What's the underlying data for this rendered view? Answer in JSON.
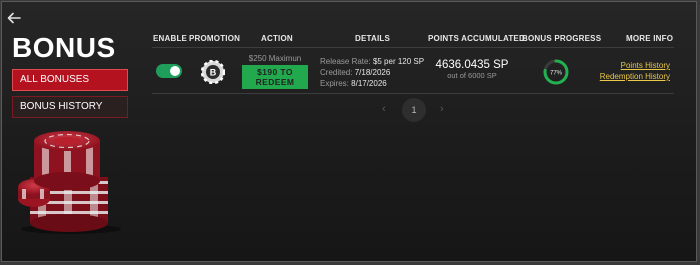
{
  "page": {
    "title": "BONUS"
  },
  "sidebar": {
    "items": [
      {
        "label": "ALL BONUSES",
        "active": true
      },
      {
        "label": "BONUS HISTORY",
        "active": false
      }
    ]
  },
  "table": {
    "headers": {
      "enable": "ENABLE",
      "promotion": "PROMOTION",
      "action": "ACTION",
      "details": "DETAILS",
      "points": "POINTS ACCUMULATED",
      "progress": "BONUS PROGRESS",
      "more": "MORE INFO"
    },
    "rows": [
      {
        "enabled": true,
        "promotion_icon": "b-chip-icon",
        "max_text": "$250 Maximun",
        "redeem_line1": "$190 TO",
        "redeem_line2": "REDEEM",
        "release_label": "Release Rate:",
        "release_value": "$5 per 120 SP",
        "credited_label": "Credited:",
        "credited_value": "7/18/2026",
        "expires_label": "Expires:",
        "expires_value": "8/17/2026",
        "points": "4636.0435 SP",
        "points_sub": "out of 6000 SP",
        "progress_label": "77%",
        "progress_value": 0.77,
        "link_points": "Points History",
        "link_redemption": "Redemption History"
      }
    ]
  },
  "pager": {
    "prev": "‹",
    "page": "1",
    "next": "›"
  },
  "colors": {
    "accent_red": "#b3121e",
    "redeem_green": "#22a94d",
    "toggle_green": "#1e9e5a",
    "link_gold": "#e9c84a"
  }
}
